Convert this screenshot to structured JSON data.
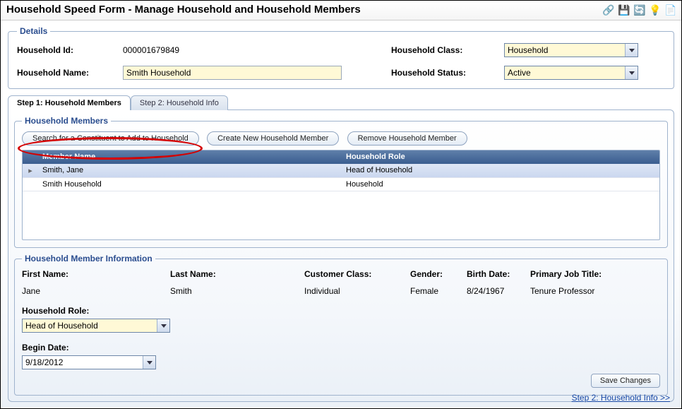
{
  "title": "Household Speed Form - Manage Household and Household Members",
  "details": {
    "legend": "Details",
    "householdIdLabel": "Household Id:",
    "householdIdValue": "000001679849",
    "householdNameLabel": "Household Name:",
    "householdNameValue": "Smith Household",
    "householdClassLabel": "Household Class:",
    "householdClassValue": "Household",
    "householdStatusLabel": "Household Status:",
    "householdStatusValue": "Active"
  },
  "tabs": {
    "step1": "Step 1: Household Members",
    "step2": "Step 2: Household Info"
  },
  "members": {
    "legend": "Household Members",
    "btnSearch": "Search for a Constituent to Add to Household",
    "btnCreate": "Create New Household Member",
    "btnRemove": "Remove Household Member",
    "colMember": "Member Name",
    "colRole": "Household Role",
    "rows": [
      {
        "name": "Smith, Jane",
        "role": "Head of Household",
        "selected": true
      },
      {
        "name": "Smith Household",
        "role": "Household",
        "selected": false
      }
    ]
  },
  "memberInfo": {
    "legend": "Household Member Information",
    "firstNameLabel": "First Name:",
    "firstNameValue": "Jane",
    "lastNameLabel": "Last Name:",
    "lastNameValue": "Smith",
    "customerClassLabel": "Customer Class:",
    "customerClassValue": "Individual",
    "genderLabel": "Gender:",
    "genderValue": "Female",
    "birthDateLabel": "Birth Date:",
    "birthDateValue": "8/24/1967",
    "jobTitleLabel": "Primary Job Title:",
    "jobTitleValue": "Tenure Professor",
    "householdRoleLabel": "Household Role:",
    "householdRoleValue": "Head of Household",
    "beginDateLabel": "Begin Date:",
    "beginDateValue": "9/18/2012",
    "saveBtn": "Save Changes"
  },
  "footerLink": "Step 2: Household Info >>"
}
